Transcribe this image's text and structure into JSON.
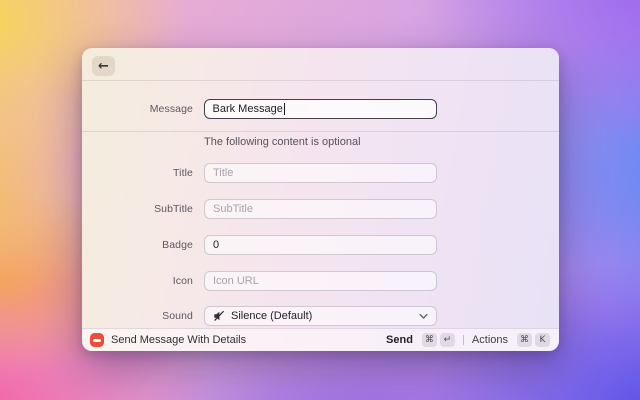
{
  "window": {
    "header": {
      "back_glyph": "←"
    },
    "form": {
      "message": {
        "label": "Message",
        "value": "Bark Message"
      },
      "optional_note": "The following content is optional",
      "rows": [
        {
          "label": "Title",
          "placeholder": "Title"
        },
        {
          "label": "SubTitle",
          "placeholder": "SubTitle"
        },
        {
          "label": "Badge",
          "value": "0"
        },
        {
          "label": "Icon",
          "placeholder": "Icon URL"
        },
        {
          "label": "Sound",
          "value": "Silence (Default)"
        }
      ]
    },
    "footer": {
      "command_label": "Send Message With Details",
      "send": {
        "label": "Send",
        "keys": [
          "⌘",
          "↵"
        ]
      },
      "actions": {
        "label": "Actions",
        "keys": [
          "⌘",
          "K"
        ]
      }
    }
  },
  "colors": {
    "bark_red": "#EB4D3D",
    "focus_border": "#44404A",
    "window_tint_left": "#F4EDDC",
    "window_tint_right": "#E8E2F6"
  }
}
